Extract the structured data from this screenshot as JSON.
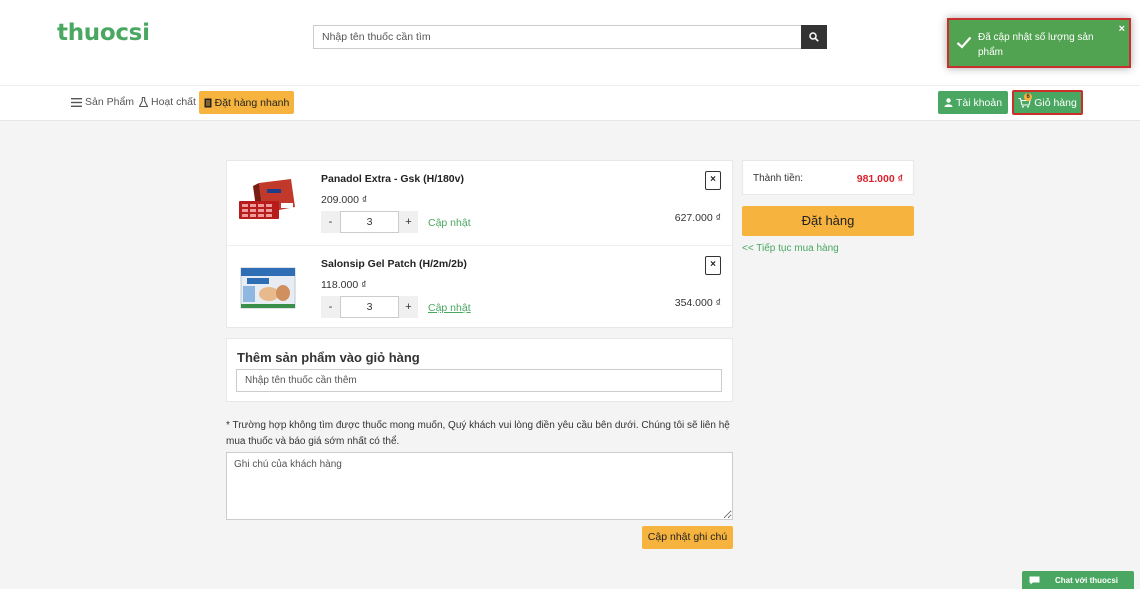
{
  "header": {
    "logo_text": "thuocsi",
    "search": {
      "placeholder": "Nhập tên thuốc cần tìm",
      "icon": "search-icon"
    }
  },
  "toast": {
    "message": "Đã cập nhật số lượng sản phẩm",
    "close_label": "×",
    "color": "#51a351"
  },
  "nav": {
    "products_label": "Sản Phẩm",
    "ingredients_label": "Hoạt chất",
    "quick_order_label": "Đặt hàng nhanh",
    "account_label": "Tài khoản",
    "cart_label": "Giỏ hàng",
    "cart_badge": "6"
  },
  "cart": {
    "items": [
      {
        "name": "Panadol Extra - Gsk (H/180v)",
        "price": "209.000 ₫",
        "quantity": "3",
        "minus_label": "-",
        "plus_label": "+",
        "update_label": "Cập nhật",
        "remove_label": "×",
        "line_total": "627.000 ₫"
      },
      {
        "name": "Salonsip Gel Patch (H/2m/2b)",
        "price": "118.000 ₫",
        "quantity": "3",
        "minus_label": "-",
        "plus_label": "+",
        "update_label": "Cập nhật",
        "remove_label": "×",
        "line_total": "354.000 ₫"
      }
    ]
  },
  "summary": {
    "total_label": "Thành tiền:",
    "total_value": "981.000 ₫",
    "order_button": "Đặt hàng",
    "continue_link": "<< Tiếp tục mua hàng"
  },
  "add_product": {
    "title": "Thêm sản phẩm vào giỏ hàng",
    "placeholder": "Nhập tên thuốc cần thêm"
  },
  "note": {
    "instruction": "* Trường hợp không tìm được thuốc mong muốn, Quý khách vui lòng điền yêu cầu bên dưới. Chúng tôi sẽ liên hệ mua thuốc và báo giá sớm nhất có thể.",
    "placeholder": "Ghi chú của khách hàng",
    "update_button": "Cập nhật ghi chú"
  },
  "chat": {
    "label": "Chat với thuocsi"
  },
  "colors": {
    "brand_green": "#49a761",
    "accent_orange": "#f6b33d",
    "price_red": "#d9232d"
  }
}
